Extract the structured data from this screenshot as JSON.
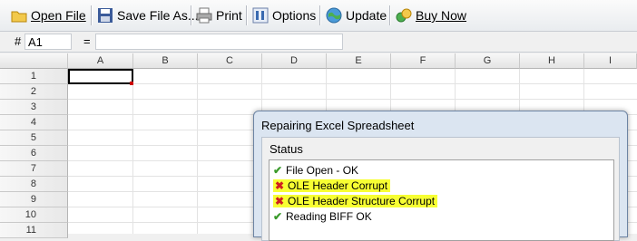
{
  "toolbar": {
    "open_label": "Open File",
    "save_label": "Save File As...",
    "print_label": "Print",
    "options_label": "Options",
    "update_label": "Update",
    "buy_label": "Buy Now"
  },
  "formula_bar": {
    "hash": "#",
    "cell_ref": "A1",
    "equals": "="
  },
  "grid": {
    "columns": [
      "A",
      "B",
      "C",
      "D",
      "E",
      "F",
      "G",
      "H",
      "I"
    ],
    "rows": [
      "1",
      "2",
      "3",
      "4",
      "5",
      "6",
      "7",
      "8",
      "9",
      "10",
      "11"
    ]
  },
  "dialog": {
    "title": "Repairing Excel Spreadsheet",
    "group_label": "Status",
    "items": [
      {
        "mark": "✔",
        "text": "File Open - OK",
        "status": "ok"
      },
      {
        "mark": "✖",
        "text": "OLE Header Corrupt",
        "status": "error"
      },
      {
        "mark": "✖",
        "text": "OLE Header Structure Corrupt",
        "status": "error"
      },
      {
        "mark": "✔",
        "text": "Reading BIFF OK",
        "status": "ok"
      }
    ],
    "highlight_color": "#f7ff33"
  }
}
